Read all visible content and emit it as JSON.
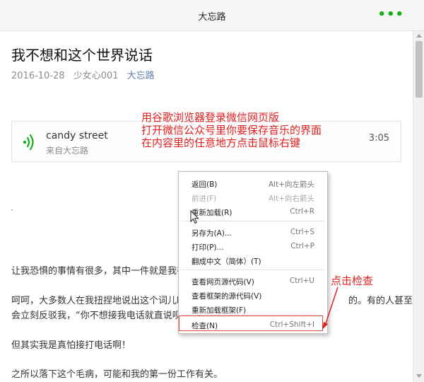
{
  "window": {
    "title": "大忘路",
    "menu_icon": "more-dots-icon"
  },
  "article": {
    "title": "我不想和这个世界说话",
    "date": "2016-10-28",
    "author": "少女心001",
    "account": "大忘路"
  },
  "music": {
    "song": "candy street",
    "source": "来自大忘路",
    "duration": "3:05",
    "icon": "sound-wave-icon"
  },
  "annotations": {
    "steps": [
      "用谷歌浏览器登录微信网页版",
      "打开微信公众号里你要保存音乐的界面",
      "在内容里的任意地方点击鼠标右键"
    ],
    "click_inspect": "点击检查"
  },
  "paragraphs": [
    "让我恐惧的事情有很多，其中一件就是我有",
    "呵呵，大多数人在我扭捏地说出这个词儿时",
    "的。有的人甚至",
    "会立刻反驳我，“你不想接我电话就直说呗",
    "但其实我是真怕接打电话啊！",
    "之所以落下这个毛病，可能和我的第一份工作有关。"
  ],
  "context_menu": {
    "items": [
      {
        "label": "返回(B)",
        "shortcut": "Alt+向左箭头",
        "enabled": true
      },
      {
        "label": "前进(F)",
        "shortcut": "Alt+向右箭头",
        "enabled": false
      },
      {
        "label": "重新加载(R)",
        "shortcut": "Ctrl+R",
        "enabled": true
      },
      {
        "label": "另存为(A)...",
        "shortcut": "Ctrl+S",
        "enabled": true
      },
      {
        "label": "打印(P)...",
        "shortcut": "Ctrl+P",
        "enabled": true
      },
      {
        "label": "翻成中文（简体）(T)",
        "shortcut": "",
        "enabled": true
      },
      {
        "label": "查看网页源代码(V)",
        "shortcut": "Ctrl+U",
        "enabled": true
      },
      {
        "label": "查看框架的源代码(V)",
        "shortcut": "",
        "enabled": true
      },
      {
        "label": "重新加载框架(F)",
        "shortcut": "",
        "enabled": true
      },
      {
        "label": "检查(N)",
        "shortcut": "Ctrl+Shift+I",
        "enabled": true
      }
    ]
  },
  "colors": {
    "accent_green": "#1aad19",
    "annotation_red": "#e02020"
  }
}
